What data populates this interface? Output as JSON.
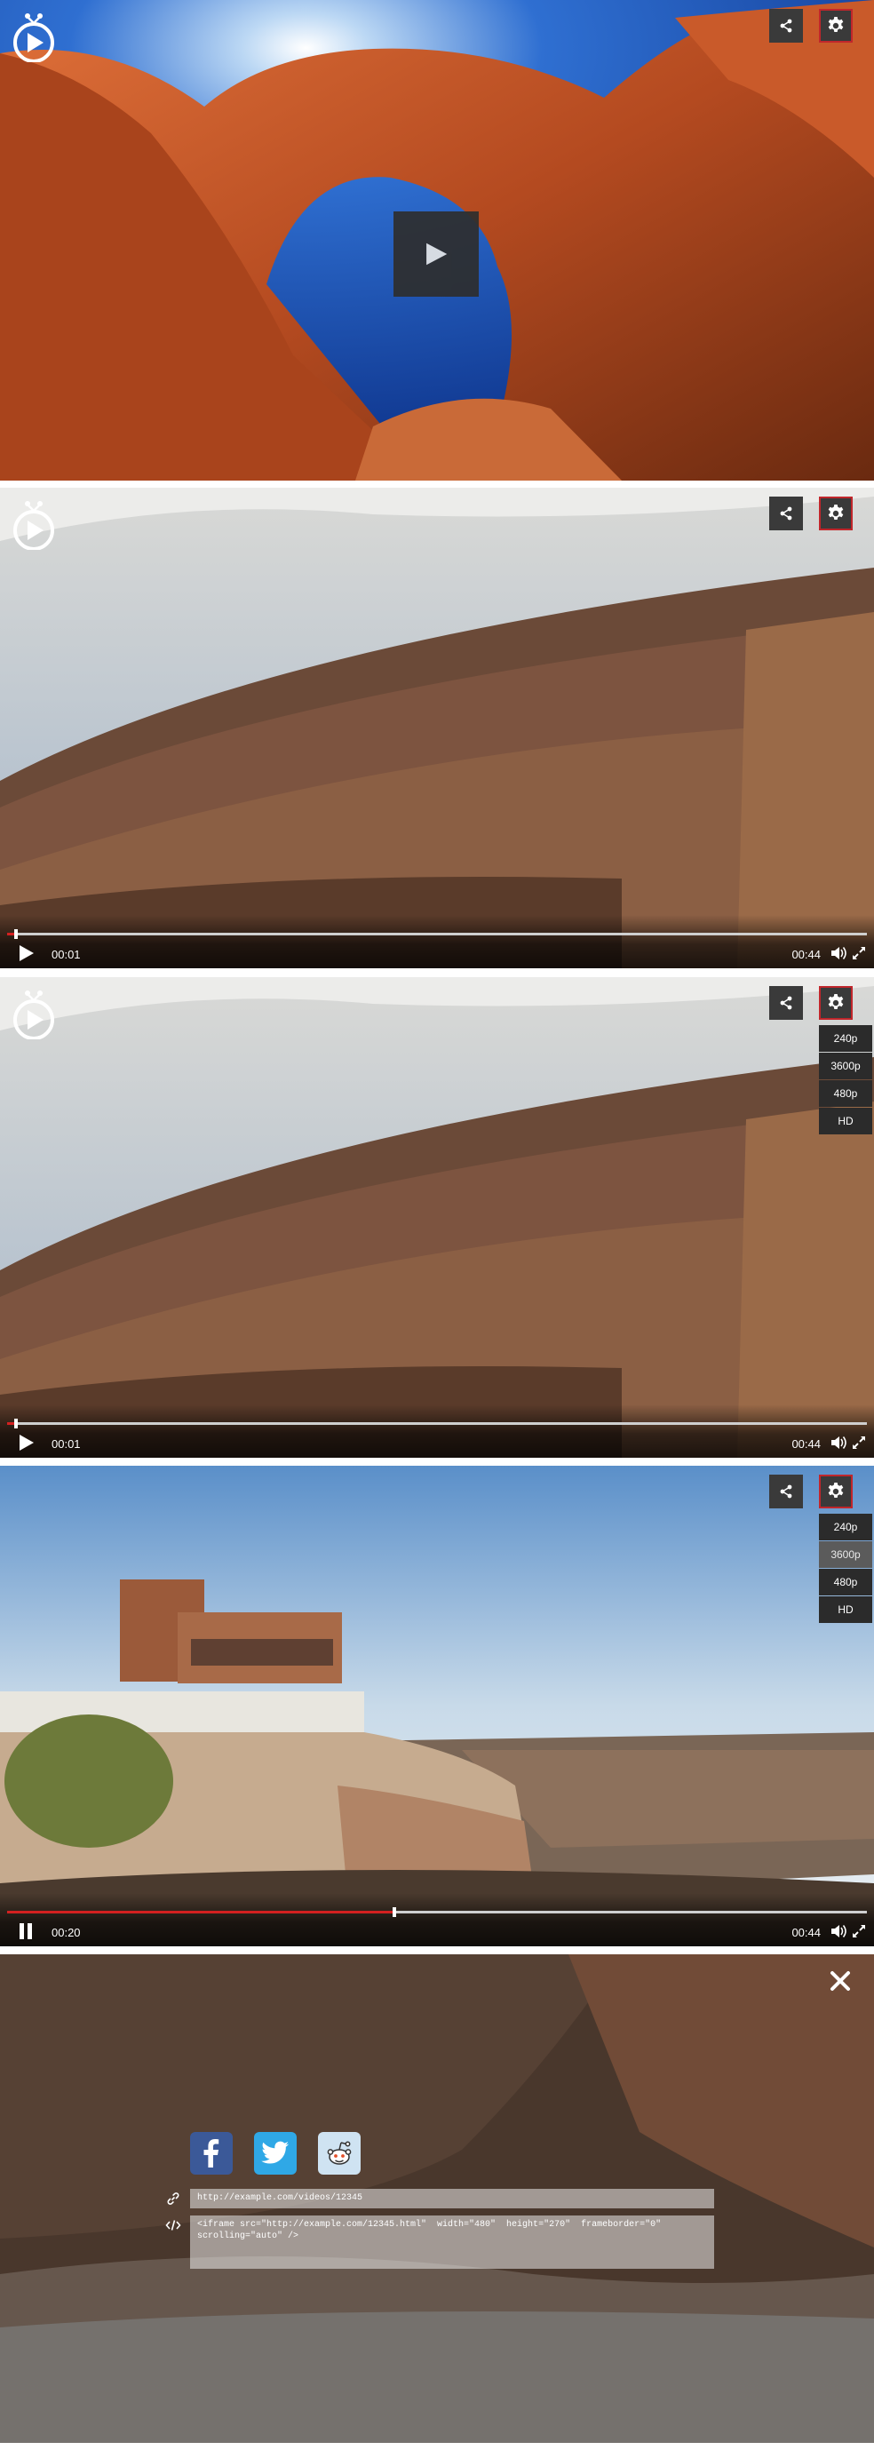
{
  "panels": [
    {
      "id": "thumbnail-state",
      "controls": false,
      "big_play": true
    },
    {
      "id": "start-state",
      "controls": true,
      "time_current": "00:01",
      "time_duration": "00:44",
      "progress": 0.01
    },
    {
      "id": "quality-menu-state",
      "controls": true,
      "time_current": "00:01",
      "time_duration": "00:44",
      "progress": 0.01,
      "quality_menu": [
        "240p",
        "3600p",
        "480p",
        "HD"
      ]
    },
    {
      "id": "playing-quality-state",
      "controls": true,
      "time_current": "00:20",
      "time_duration": "00:44",
      "progress": 0.45,
      "quality_menu": [
        "240p",
        "3600p",
        "480p",
        "HD"
      ],
      "quality_highlighted": "3600p"
    },
    {
      "id": "share-overlay-state",
      "close_icon": "close-icon",
      "share": {
        "networks": [
          "facebook",
          "twitter",
          "reddit"
        ],
        "url": "http://example.com/videos/12345",
        "embed": "<iframe src=\"http://example.com/12345.html\"  width=\"480\"  height=\"270\"  frameborder=\"0\"\nscrolling=\"auto\" />"
      }
    }
  ],
  "p2": {
    "time_current": "00:01",
    "time_duration": "00:44"
  },
  "p3": {
    "time_current": "00:01",
    "time_duration": "00:44",
    "q": [
      "240p",
      "3600p",
      "480p",
      "HD"
    ]
  },
  "p4": {
    "time_current": "00:20",
    "time_duration": "00:44",
    "q": [
      "240p",
      "3600p",
      "480p",
      "HD"
    ]
  },
  "p5": {
    "url": "http://example.com/videos/12345",
    "embed": "<iframe src=\"http://example.com/12345.html\"  width=\"480\"  height=\"270\"  frameborder=\"0\"\nscrolling=\"auto\" />"
  },
  "colors": {
    "accent_red": "#d42020",
    "gear_border": "#c0262b",
    "facebook": "#3b5998",
    "twitter": "#2fa8e6",
    "reddit": "#cfe3f2"
  }
}
